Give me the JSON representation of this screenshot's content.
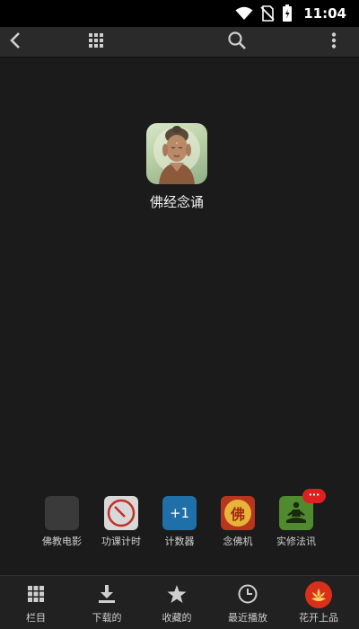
{
  "status_bar": {
    "time": "11:04",
    "icons": [
      "wifi-icon",
      "no-sim-icon",
      "battery-icon"
    ]
  },
  "toolbar": {
    "back_icon": "chevron-left-icon",
    "grid_icon": "grid-icon",
    "search_icon": "search-icon",
    "more_icon": "more-vertical-icon"
  },
  "featured": {
    "label": "佛经念诵",
    "icon": "buddha-icon"
  },
  "shortcuts": [
    {
      "label": "佛教电影",
      "icon": "blank-app-icon",
      "color": "#3a3a3a"
    },
    {
      "label": "功课计时",
      "icon": "timer-icon",
      "color": "#d8d8d8"
    },
    {
      "label": "计数器",
      "icon": "counter-icon",
      "color": "#1f6fa8",
      "text": "+1"
    },
    {
      "label": "念佛机",
      "icon": "fo-icon",
      "color": "#b8361e",
      "text": "佛"
    },
    {
      "label": "实修法讯",
      "icon": "meditation-icon",
      "color": "#4f8a2e",
      "badge": "···"
    }
  ],
  "bottom_nav": [
    {
      "label": "栏目",
      "icon": "grid-icon"
    },
    {
      "label": "下载的",
      "icon": "download-icon"
    },
    {
      "label": "收藏的",
      "icon": "star-icon"
    },
    {
      "label": "最近播放",
      "icon": "clock-icon"
    },
    {
      "label": "花开上品",
      "icon": "lotus-icon",
      "color": "#d9301c"
    }
  ]
}
